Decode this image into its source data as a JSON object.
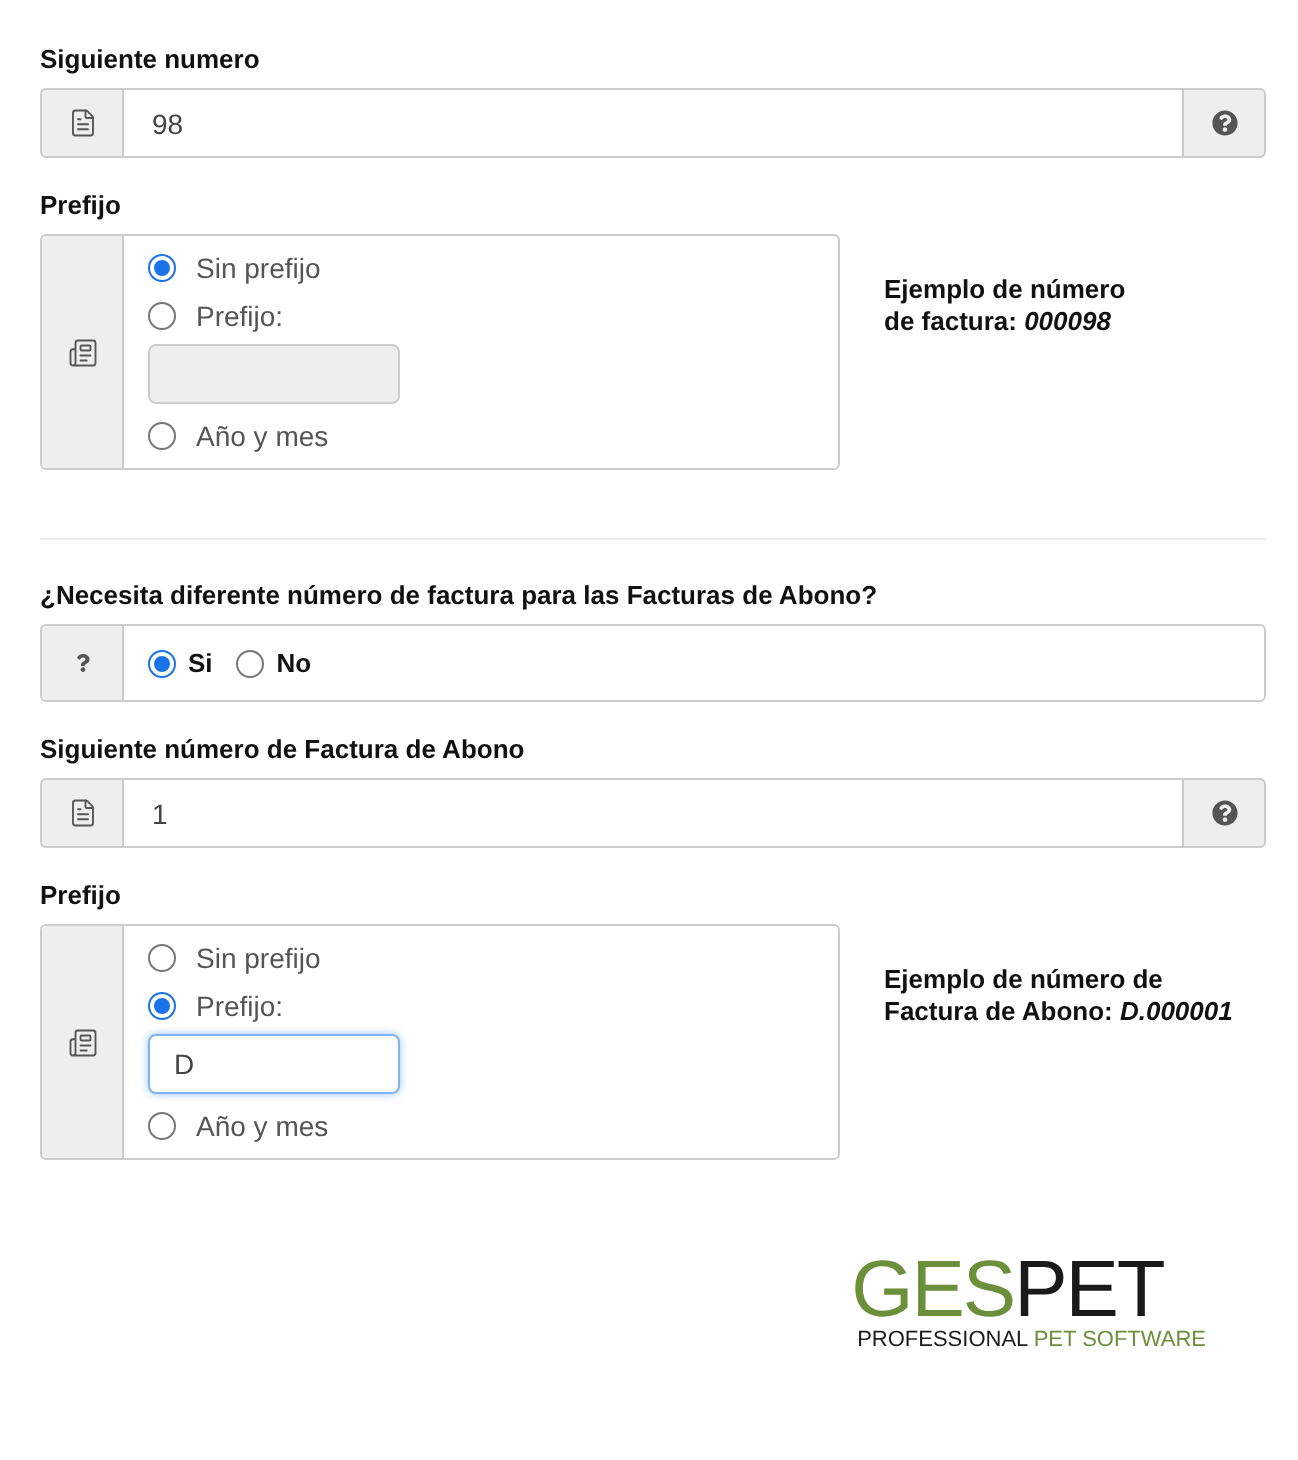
{
  "next_number": {
    "label": "Siguiente numero",
    "value": "98"
  },
  "prefix": {
    "label": "Prefijo",
    "options": [
      {
        "kind": "radio",
        "label": "Sin prefijo",
        "selected": true
      },
      {
        "kind": "input",
        "label": "Prefijo:",
        "selected": false,
        "field": {
          "disabled": true,
          "focused": false
        }
      },
      {
        "kind": "radio",
        "label": "Año y mes",
        "selected": false
      }
    ],
    "example": "Ejemplo de número\nde factura: *000098*"
  },
  "credit_question": {
    "label": "¿Necesita diferente número de factura para las Facturas de Abono?",
    "options": [
      {
        "label": "Si",
        "selected": true
      },
      {
        "label": "No",
        "selected": false
      }
    ]
  },
  "credit_next_number": {
    "label": "Siguiente número de Factura de Abono",
    "value": "1"
  },
  "credit_prefix": {
    "label": "Prefijo",
    "options": [
      {
        "kind": "radio",
        "label": "Sin prefijo",
        "selected": false
      },
      {
        "kind": "input",
        "label": "Prefijo:",
        "selected": true,
        "field": {
          "value": "D",
          "disabled": false,
          "focused": true
        }
      },
      {
        "kind": "radio",
        "label": "Año y mes",
        "selected": false
      }
    ],
    "example": "Ejemplo de número de\nFactura de Abono: *D.000001*"
  },
  "logo": {
    "word": [
      {
        "text": "GES",
        "accent": true
      },
      {
        "text": "PET",
        "accent": false
      }
    ],
    "tagline": [
      {
        "text": "PROFESSIONAL",
        "accent": false
      },
      {
        "text": "PET SOFTWARE",
        "accent": true
      }
    ]
  }
}
